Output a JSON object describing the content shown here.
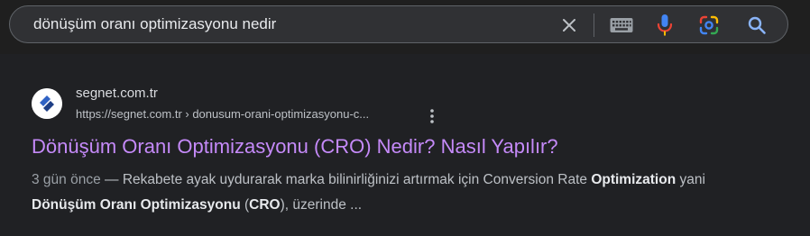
{
  "search": {
    "query": "dönüşüm oranı optimizasyonu nedir",
    "icons": {
      "clear": "close-icon",
      "keyboard": "keyboard-icon",
      "voice": "microphone-icon",
      "lens": "google-lens-icon",
      "search": "magnifier-icon"
    }
  },
  "result": {
    "favicon": "segnet-logo",
    "site_name": "segnet.com.tr",
    "url": "https://segnet.com.tr › donusum-orani-optimizasyonu-c...",
    "title": "Dönüşüm Oranı Optimizasyonu (CRO) Nedir? Nasıl Yapılır?",
    "snippet": {
      "date": "3 gün önce",
      "sep": " — ",
      "t1": "Rekabete ayak uydurarak marka bilinirliğinizi artırmak için Conversion Rate ",
      "b1": "Optimization",
      "t2": " yani ",
      "b2": "Dönüşüm Oranı Optimizasyonu",
      "t3": " (",
      "b3": "CRO",
      "t4": "), üzerinde ..."
    }
  },
  "colors": {
    "background": "#202124",
    "title_link": "#c58af9",
    "mic_blue": "#4285f4",
    "mic_red": "#ea4335"
  }
}
